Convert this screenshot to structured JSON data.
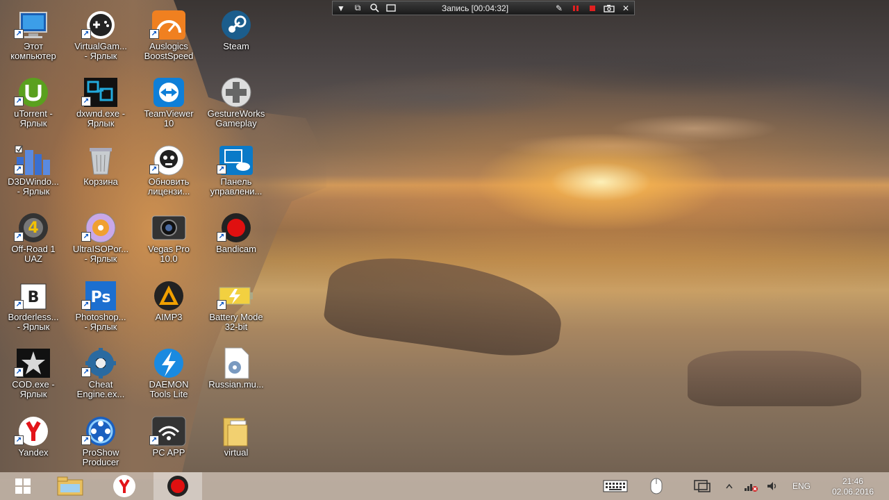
{
  "recorder": {
    "title": "Запись [00:04:32]"
  },
  "desktop": {
    "icons": [
      {
        "label": "Этот\nкомпьютер",
        "icon": "computer-icon"
      },
      {
        "label": "VirtualGam...\n- Ярлык",
        "icon": "gamepad-icon"
      },
      {
        "label": "Auslogics\nBoostSpeed",
        "icon": "speedometer-icon"
      },
      {
        "label": "Steam",
        "icon": "steam-icon"
      },
      {
        "label": "uTorrent -\nЯрлык",
        "icon": "utorrent-icon"
      },
      {
        "label": "dxwnd.exe -\nЯрлык",
        "icon": "dxwnd-icon"
      },
      {
        "label": "TeamViewer\n10",
        "icon": "teamviewer-icon"
      },
      {
        "label": "GestureWorks\nGameplay",
        "icon": "dpad-icon"
      },
      {
        "label": "D3DWindo...\n- Ярлык",
        "icon": "d3dwindower-icon"
      },
      {
        "label": "Корзина",
        "icon": "recycle-bin-icon"
      },
      {
        "label": "Обновить\nлицензи...",
        "icon": "skull-icon"
      },
      {
        "label": "Панель\nуправлени...",
        "icon": "intel-panel-icon"
      },
      {
        "label": "Off-Road 1\nUAZ",
        "icon": "offroad-icon"
      },
      {
        "label": "UltraISOPor...\n- Ярлык",
        "icon": "disc-icon"
      },
      {
        "label": "Vegas Pro\n10.0",
        "icon": "vegas-icon"
      },
      {
        "label": "Bandicam",
        "icon": "bandicam-icon"
      },
      {
        "label": "Borderless...\n- Ярлык",
        "icon": "borderless-icon"
      },
      {
        "label": "Photoshop...\n- Ярлык",
        "icon": "photoshop-icon"
      },
      {
        "label": "AIMP3",
        "icon": "aimp-icon"
      },
      {
        "label": "Battery Mode\n32-bit",
        "icon": "battery-icon"
      },
      {
        "label": "COD.exe -\nЯрлык",
        "icon": "star-icon"
      },
      {
        "label": "Cheat\nEngine.ex...",
        "icon": "cheat-engine-icon"
      },
      {
        "label": "DAEMON\nTools Lite",
        "icon": "daemon-tools-icon"
      },
      {
        "label": "Russian.mu...",
        "icon": "settings-file-icon"
      },
      {
        "label": "Yandex",
        "icon": "yandex-icon"
      },
      {
        "label": "ProShow\nProducer",
        "icon": "proshow-icon"
      },
      {
        "label": "PC APP",
        "icon": "wifi-app-icon"
      },
      {
        "label": "virtual",
        "icon": "folder-icon"
      }
    ]
  },
  "taskbar": {
    "lang": "ENG",
    "time": "21:46",
    "date": "02.06.2016"
  }
}
